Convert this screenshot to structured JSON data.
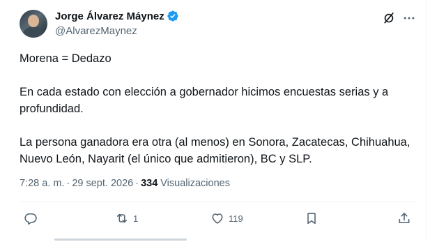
{
  "author": {
    "name": "Jorge Álvarez Máynez",
    "handle": "@AlvarezMaynez",
    "verified_color": "#1d9bf0"
  },
  "post": {
    "lines": [
      "Morena = Dedazo",
      "En cada estado con elección a gobernador hicimos encuestas serias y a profundidad.",
      "La persona ganadora era otra (al menos) en Sonora, Zacatecas, Chihuahua, Nuevo León, Nayarit (el único que admitieron), BC y SLP."
    ]
  },
  "meta": {
    "time": "7:28 a. m.",
    "separator": "·",
    "date": "29 sept. 2026",
    "views_count": "334",
    "views_label": "Visualizaciones"
  },
  "actions": {
    "reply_icon": "reply-icon",
    "retweet_icon": "retweet-icon",
    "retweet_count": "1",
    "like_icon": "heart-icon",
    "like_count": "119",
    "bookmark_icon": "bookmark-icon",
    "share_icon": "share-icon"
  },
  "colors": {
    "text": "#0f1419",
    "secondary": "#536471",
    "divider": "#eff3f4"
  }
}
